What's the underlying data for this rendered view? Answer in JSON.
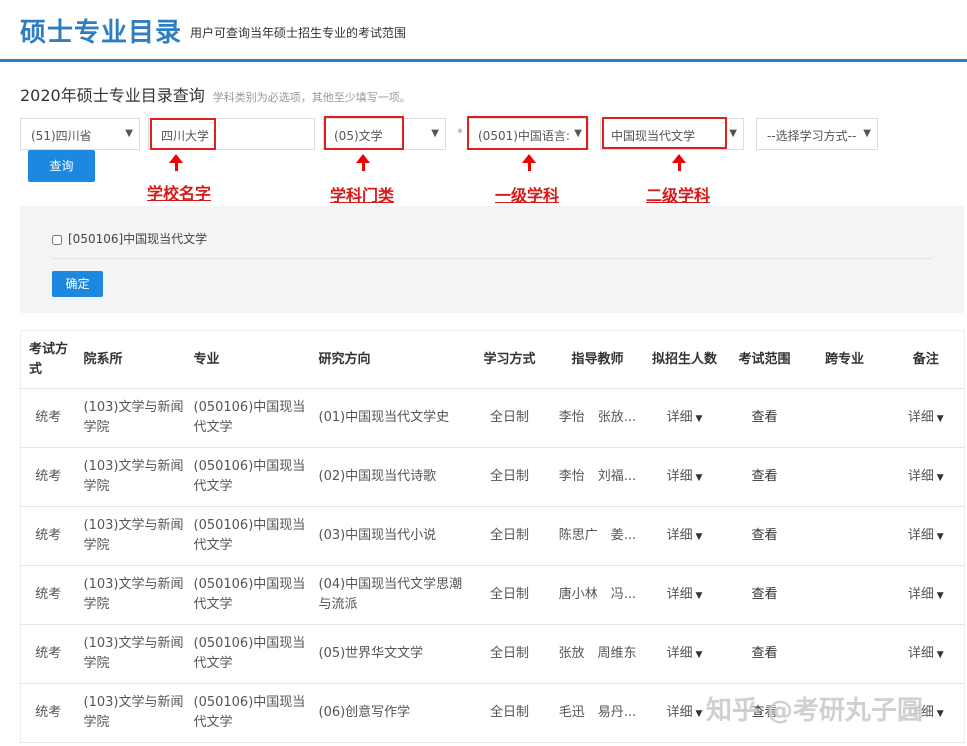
{
  "header": {
    "title": "硕士专业目录",
    "subtitle": "用户可查询当年硕士招生专业的考试范围"
  },
  "query": {
    "title": "2020年硕士专业目录查询",
    "hint": "学科类别为必选项，其他至少填写一项。",
    "province": "(51)四川省",
    "school": "四川大学",
    "category": "(05)文学",
    "first_discipline": "(0501)中国语言:",
    "second_discipline": "中国现当代文学",
    "study_mode": "--选择学习方式--",
    "search_button": "查询"
  },
  "annotations": {
    "school": "学校名字",
    "category": "学科门类",
    "first": "一级学科",
    "second": "二级学科"
  },
  "panel": {
    "checkbox_label": "[050106]中国现当代文学",
    "confirm": "确定"
  },
  "table": {
    "headers": [
      "考试方式",
      "院系所",
      "专业",
      "研究方向",
      "学习方式",
      "指导教师",
      "拟招生人数",
      "考试范围",
      "跨专业",
      "备注"
    ],
    "rows": [
      [
        "统考",
        "(103)文学与新闻学院",
        "(050106)中国现当代文学",
        "(01)中国现当代文学史",
        "全日制",
        "李怡　张放...",
        "详细",
        "查看",
        "",
        "详细"
      ],
      [
        "统考",
        "(103)文学与新闻学院",
        "(050106)中国现当代文学",
        "(02)中国现当代诗歌",
        "全日制",
        "李怡　刘福...",
        "详细",
        "查看",
        "",
        "详细"
      ],
      [
        "统考",
        "(103)文学与新闻学院",
        "(050106)中国现当代文学",
        "(03)中国现当代小说",
        "全日制",
        "陈思广　姜...",
        "详细",
        "查看",
        "",
        "详细"
      ],
      [
        "统考",
        "(103)文学与新闻学院",
        "(050106)中国现当代文学",
        "(04)中国现当代文学思潮与流派",
        "全日制",
        "唐小林　冯...",
        "详细",
        "查看",
        "",
        "详细"
      ],
      [
        "统考",
        "(103)文学与新闻学院",
        "(050106)中国现当代文学",
        "(05)世界华文文学",
        "全日制",
        "张放　周维东",
        "详细",
        "查看",
        "",
        "详细"
      ],
      [
        "统考",
        "(103)文学与新闻学院",
        "(050106)中国现当代文学",
        "(06)创意写作学",
        "全日制",
        "毛迅　易丹...",
        "详细",
        "查看",
        "",
        "详细"
      ]
    ]
  },
  "watermark": "知乎 @考研丸子圆"
}
